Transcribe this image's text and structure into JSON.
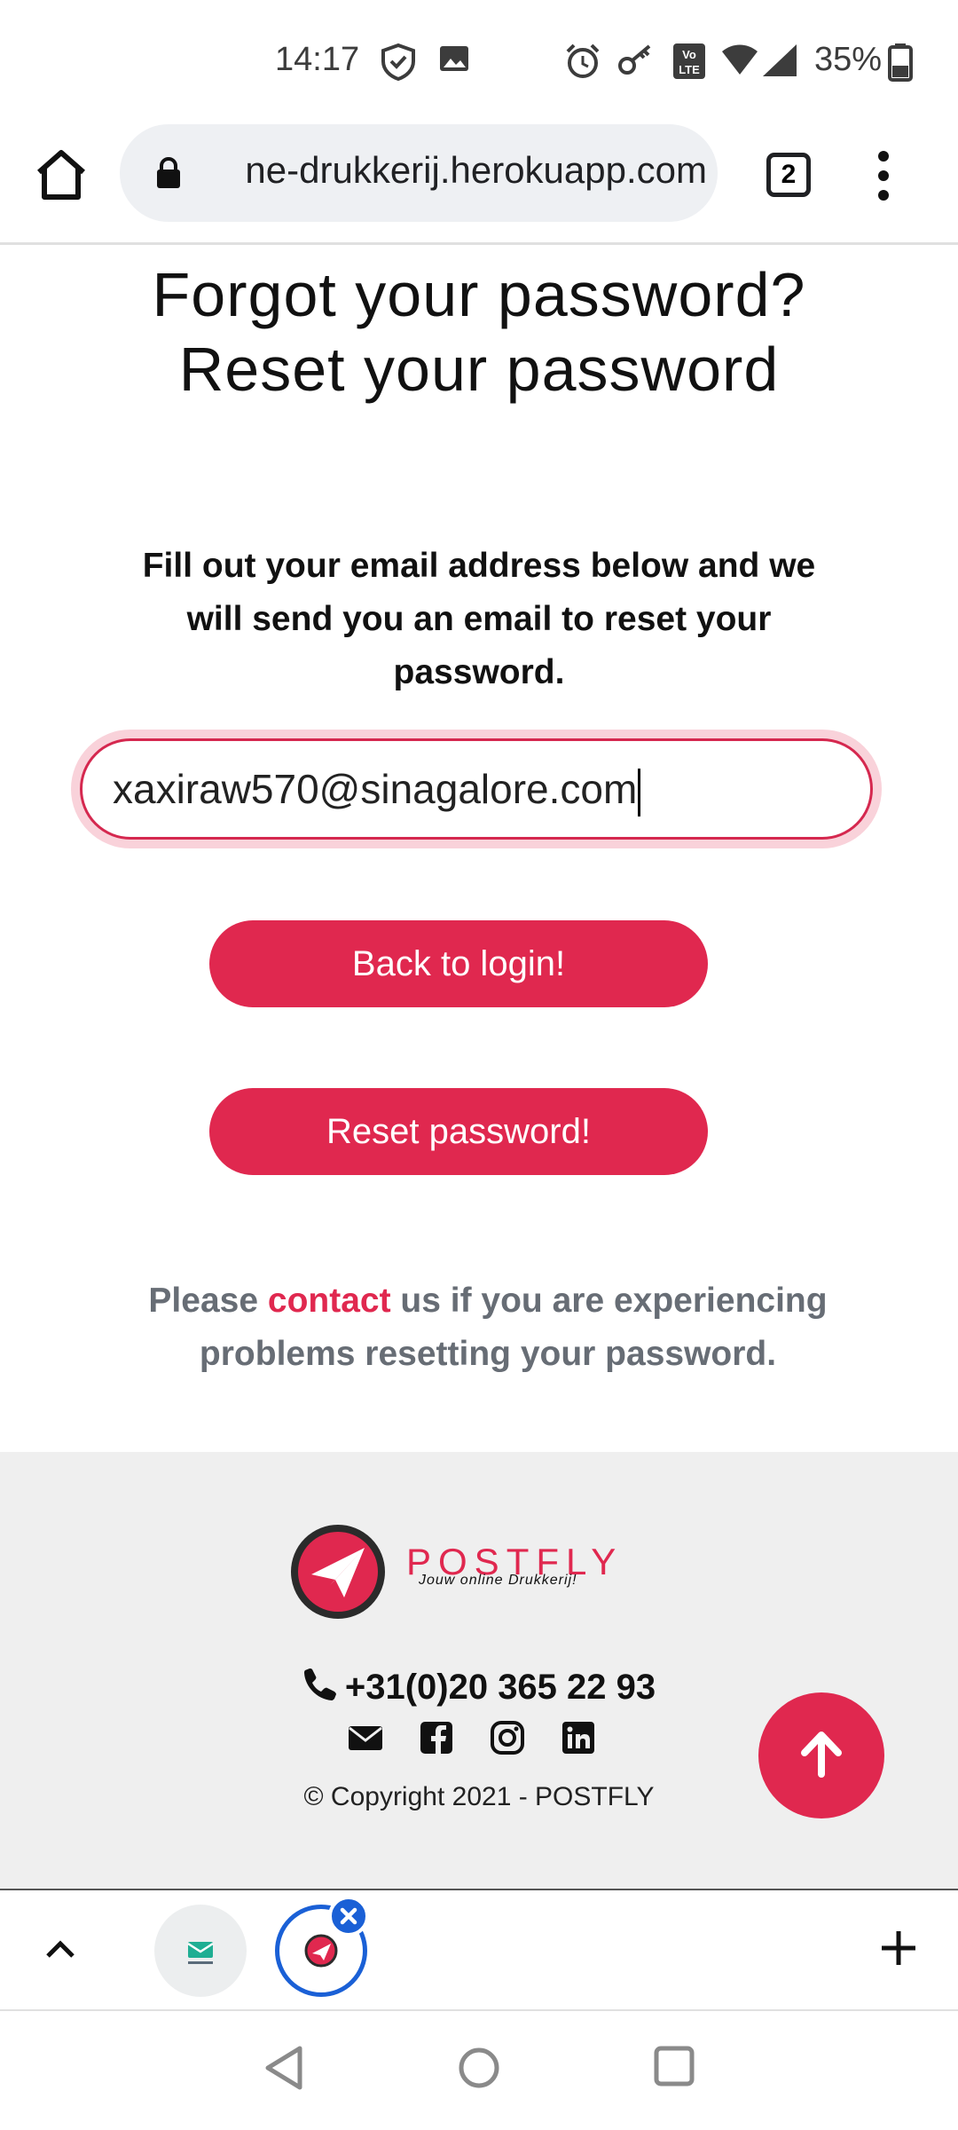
{
  "status_bar": {
    "time": "14:17",
    "battery": "35%",
    "icons": [
      "shield-icon",
      "image-icon",
      "alarm-icon",
      "key-icon",
      "volte-icon",
      "wifi-icon",
      "signal-icon",
      "battery-icon"
    ]
  },
  "browser": {
    "url": "ne-drukkerij.herokuapp.com",
    "tab_count": "2"
  },
  "page": {
    "heading_line1": "Forgot your password?",
    "heading_line2": "Reset your password",
    "intro": "Fill out your email address below and we will send you an email to reset your password.",
    "email_value": "xaxiraw570@sinagalore.com",
    "back_button": "Back to login!",
    "reset_button": "Reset password!",
    "help_prefix": "Please ",
    "help_link": "contact",
    "help_suffix": " us if you are experiencing problems resetting your password."
  },
  "footer": {
    "logo_word": "POSTFLY",
    "logo_tagline": "Jouw online Drukkerij!",
    "phone": "+31(0)20 365 22 93",
    "social_icons": [
      "envelope-icon",
      "facebook-icon",
      "instagram-icon",
      "linkedin-icon"
    ],
    "copyright": "© Copyright 2021 - POSTFLY"
  },
  "colors": {
    "accent": "#e0284f",
    "muted_text": "#676d75",
    "footer_bg": "#efefef",
    "tab_highlight": "#1a60d6"
  }
}
